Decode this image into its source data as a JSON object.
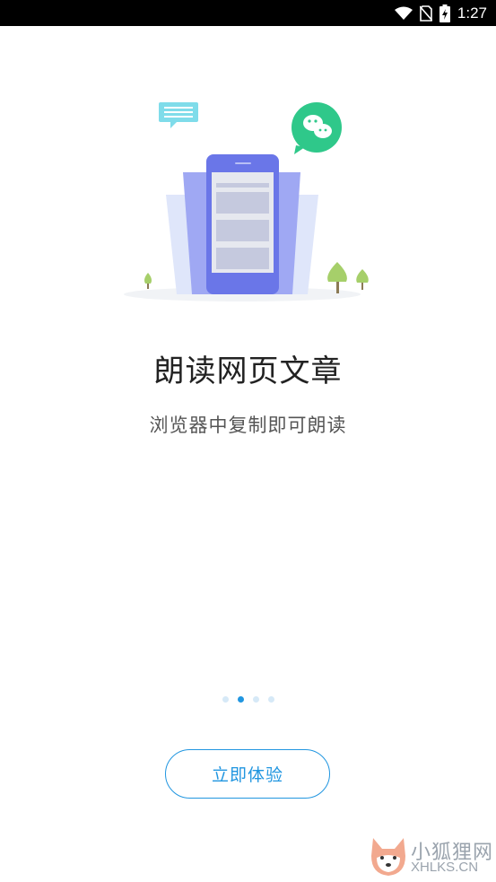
{
  "status_bar": {
    "time": "1:27",
    "icons": [
      "wifi-icon",
      "no-sim-icon",
      "battery-charging-icon"
    ]
  },
  "illustration": {
    "icons": [
      "chat-bubble-icon",
      "wechat-icon",
      "phone-icon",
      "tree-icon"
    ]
  },
  "intro": {
    "title": "朗读网页文章",
    "subtitle": "浏览器中复制即可朗读"
  },
  "pager": {
    "count": 4,
    "active_index": 1
  },
  "start_button": {
    "label": "立即体验"
  },
  "watermark": {
    "text_cn": "小狐狸网",
    "text_en": "XHLKS.CN"
  },
  "colors": {
    "accent": "#2196e0",
    "phone": "#6a76e8",
    "wechat": "#2fc88a",
    "chat_bubble": "#7fdcea",
    "tree": "#a6cf6a"
  }
}
